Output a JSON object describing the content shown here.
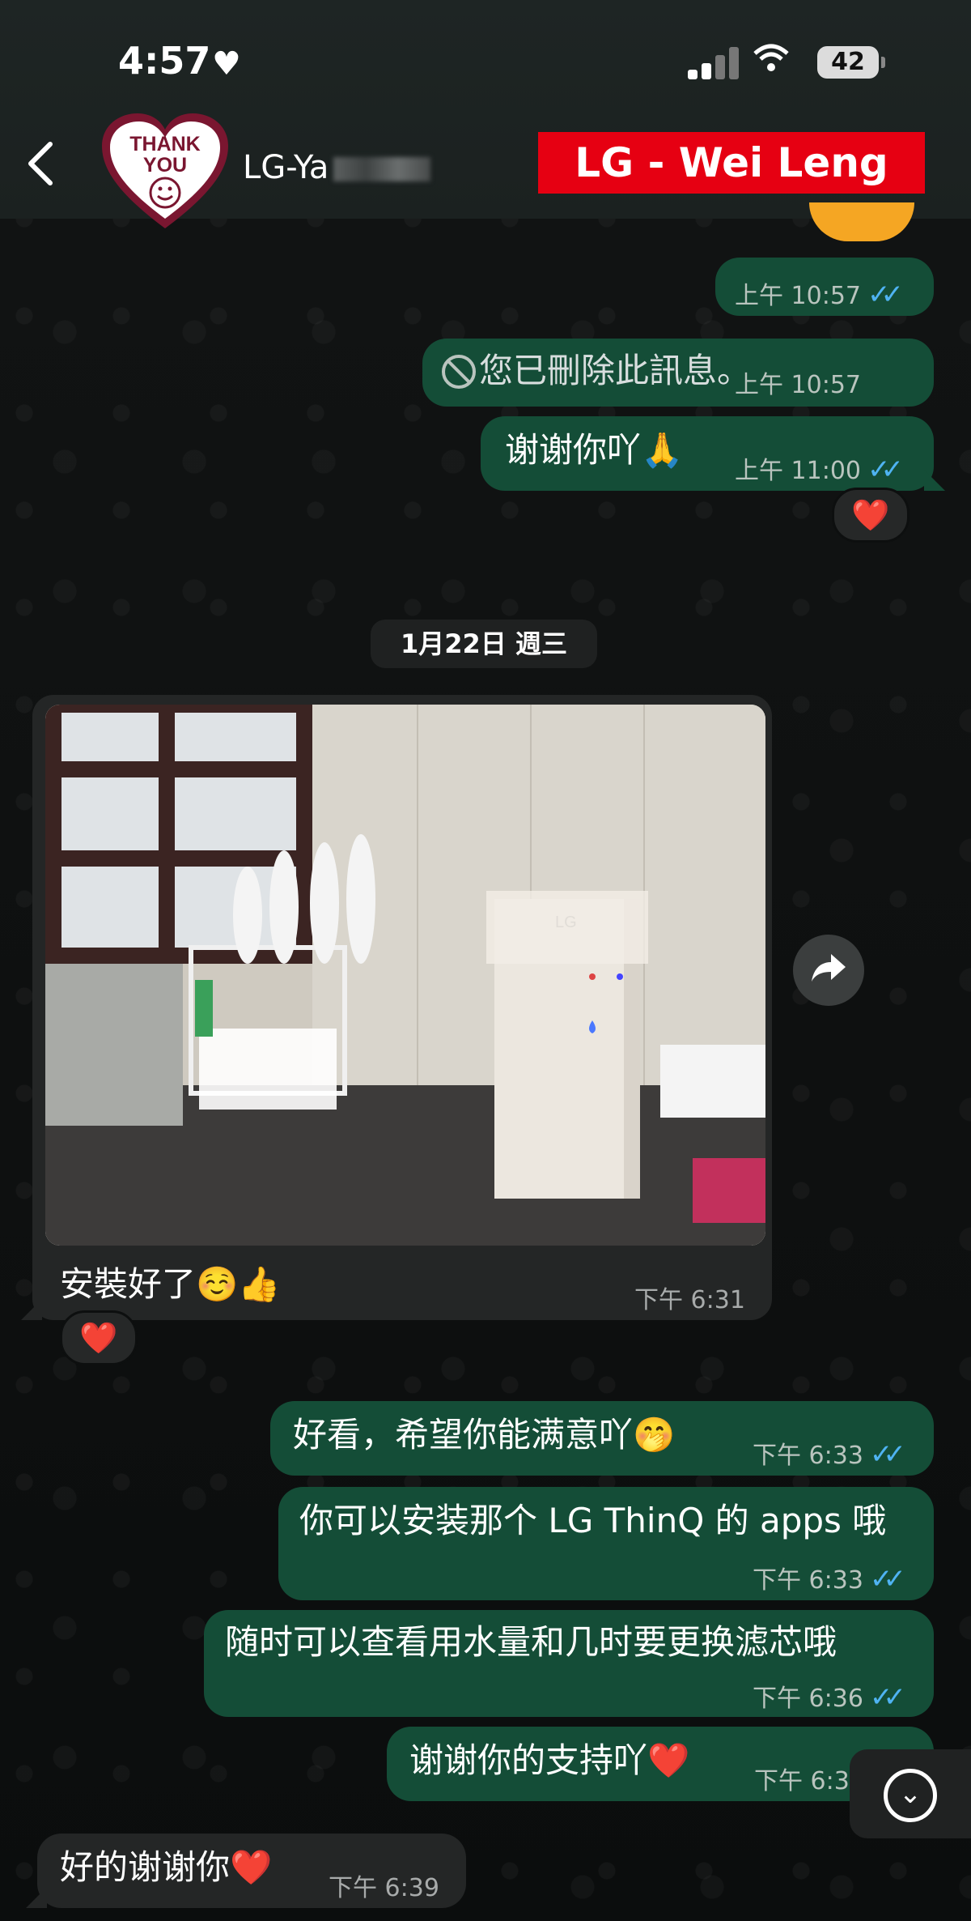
{
  "status_bar": {
    "time": "4:57",
    "battery": "42"
  },
  "header": {
    "avatar_text_line1": "THANK",
    "avatar_text_line2": "YOU",
    "contact_name": "LG-Ya",
    "overlay_label": "LG - Wei Leng"
  },
  "colors": {
    "outgoing_bubble": "#144d37",
    "incoming_bubble": "#242626",
    "read_ticks": "#4fb3f2",
    "label_red": "#e60012"
  },
  "messages": [
    {
      "direction": "out",
      "text": "",
      "time": "上午 10:57",
      "ticks": "✓✓"
    },
    {
      "direction": "out",
      "text": "您已刪除此訊息。",
      "time": "上午 10:57",
      "deleted": true
    },
    {
      "direction": "out",
      "text": "谢谢你吖🙏",
      "time": "上午 11:00",
      "ticks": "✓✓",
      "reaction": "❤️"
    },
    {
      "direction": "in",
      "text": "安裝好了☺️👍",
      "time": "下午 6:31",
      "has_photo": true,
      "reaction": "❤️"
    },
    {
      "direction": "out",
      "text": "好看，希望你能满意吖🤭",
      "time": "下午 6:33",
      "ticks": "✓✓"
    },
    {
      "direction": "out",
      "text": "你可以安装那个 LG ThinQ 的 apps 哦",
      "time": "下午 6:33",
      "ticks": "✓✓"
    },
    {
      "direction": "out",
      "text": "随时可以查看用水量和几时要更换滤芯哦",
      "time": "下午 6:36",
      "ticks": "✓✓"
    },
    {
      "direction": "out",
      "text": "谢谢你的支持吖❤️",
      "time": "下午 6:3"
    },
    {
      "direction": "in",
      "text": "好的谢谢你❤️",
      "time": "下午 6:39"
    }
  ],
  "date_separator": "1月22日 週三",
  "photo_brand": "LG",
  "icons": {
    "back": "chevron-left-icon",
    "share": "forward-icon",
    "scroll": "chevron-down-icon"
  }
}
